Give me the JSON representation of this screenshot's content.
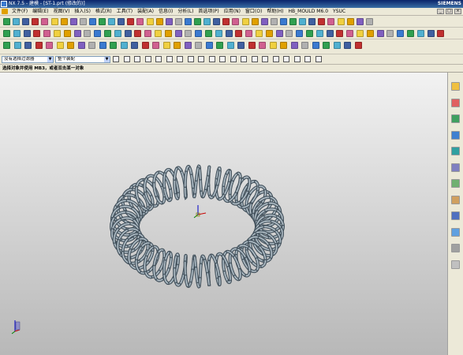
{
  "window": {
    "title": "NX 7.5 - 建模 - [ST-1.prt (修改的)]",
    "brand": "SIEMENS"
  },
  "menubar": {
    "items": [
      "文件(F)",
      "编辑(E)",
      "视图(V)",
      "插入(S)",
      "格式(R)",
      "工具(T)",
      "装配(A)",
      "信息(I)",
      "分析(L)",
      "首选项(P)",
      "应用(N)",
      "窗口(O)",
      "帮助(H)",
      "HB_MOULD M6.0",
      "YSUC"
    ]
  },
  "selection_bar": {
    "type_filter": "没有选择过滤器",
    "scope": "整个装配"
  },
  "cue_line": "选择对象并使用 MB3，或者双击某一对象",
  "colors": {
    "title_bar": "#0a246a",
    "spring": "#6e7f8b",
    "background_top": "#f2f2f2",
    "background_bottom": "#b8b8b8"
  }
}
